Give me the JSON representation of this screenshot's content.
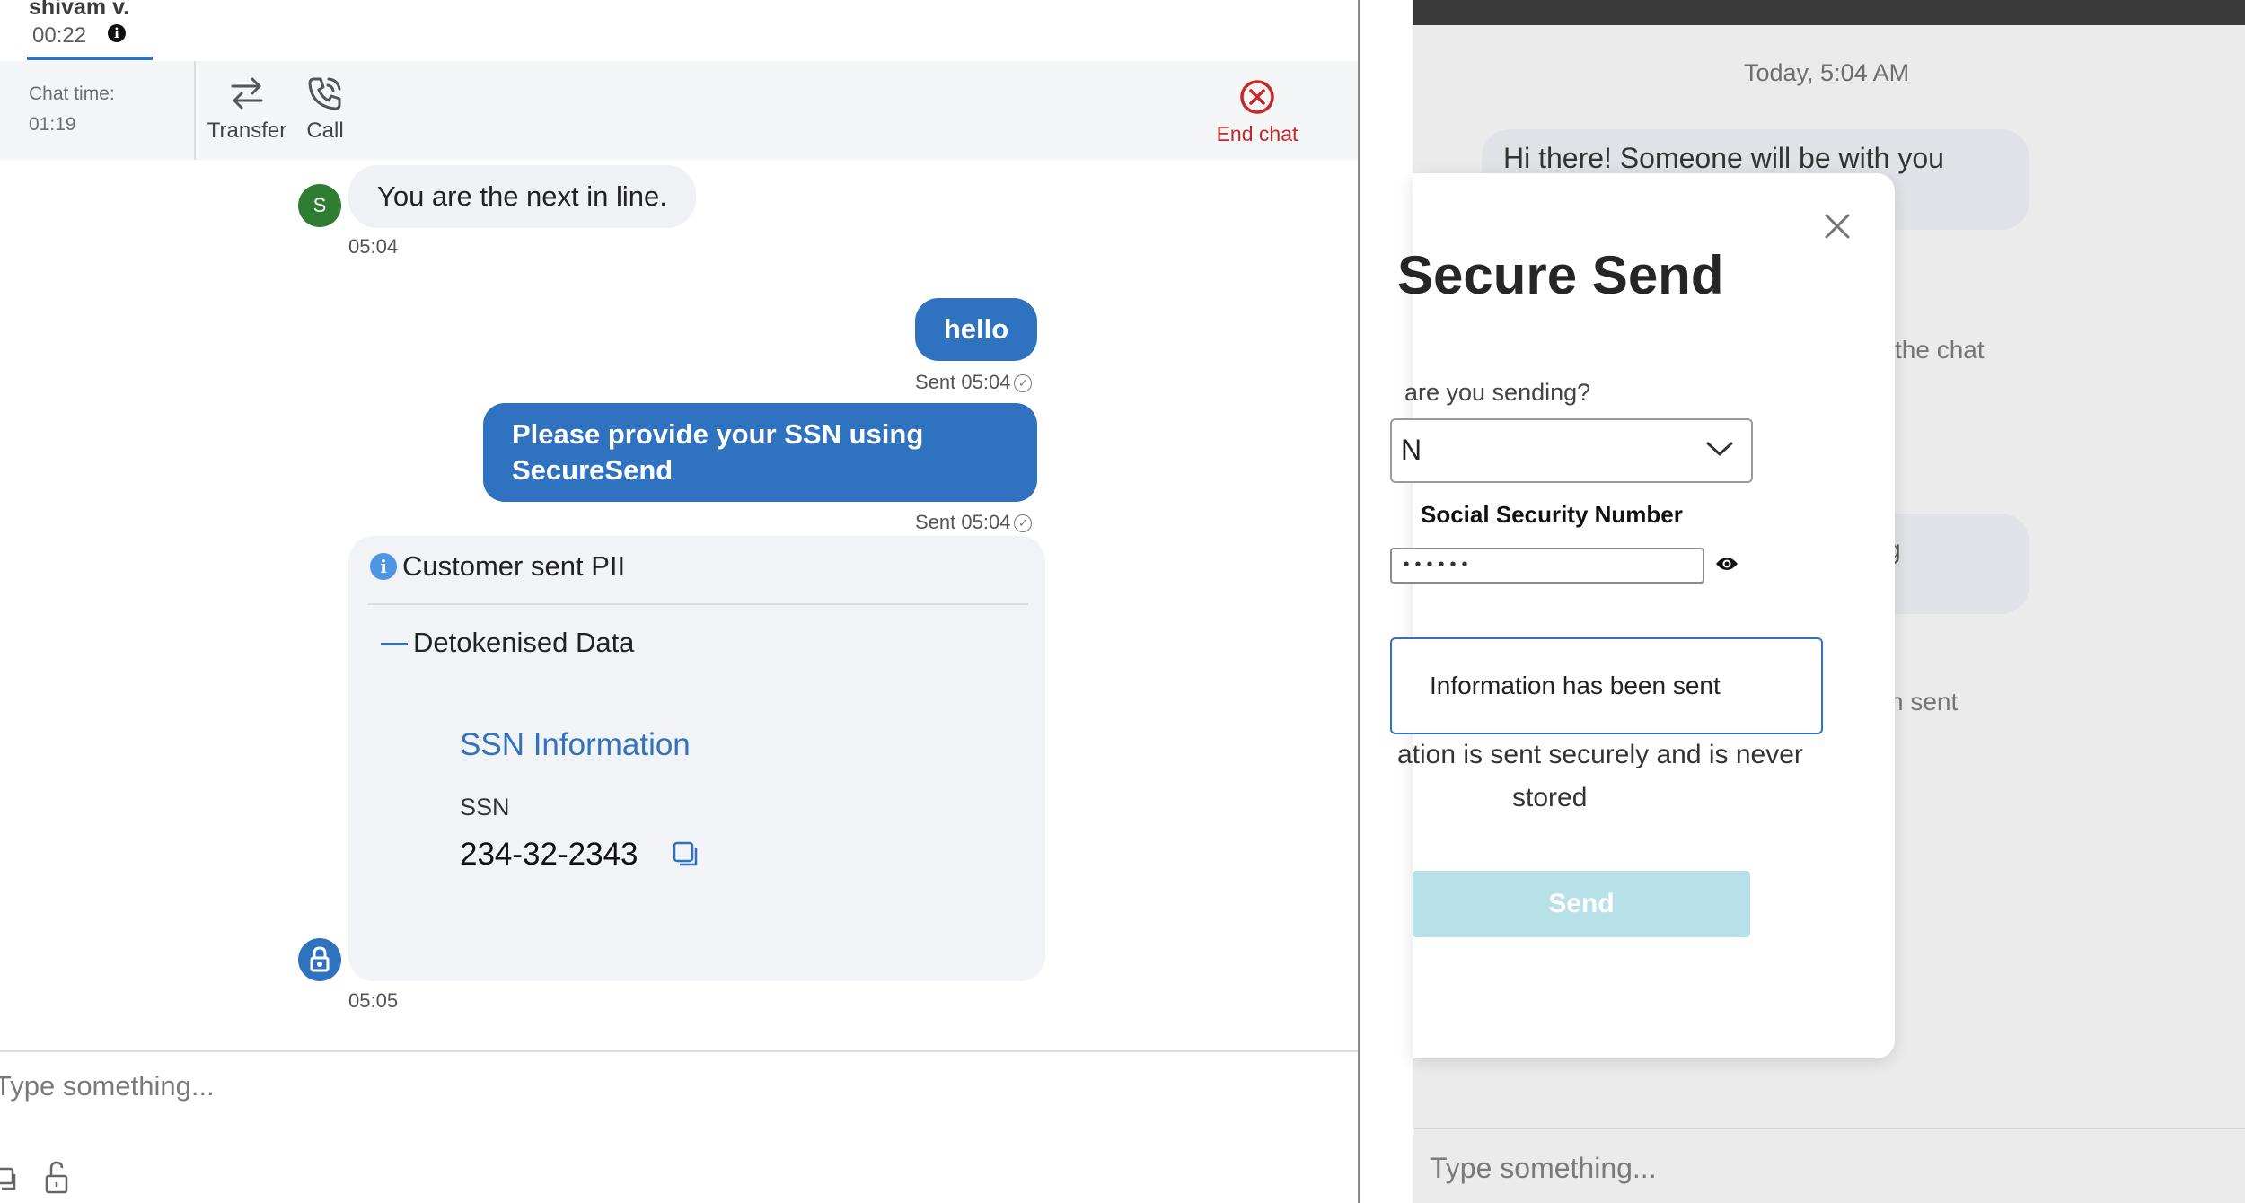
{
  "agent": {
    "name": "shivam v.",
    "timer": "00:22",
    "info_icon": "i"
  },
  "toolbar": {
    "chat_time_label": "Chat time:",
    "chat_time_value": "01:19",
    "transfer_label": "Transfer",
    "call_label": "Call",
    "end_chat_label": "End chat",
    "accent": "#2f73c0",
    "end_chat_color": "#c62828"
  },
  "messages": {
    "incoming_avatar": "S",
    "incoming_text": "You are the next in line.",
    "incoming_time": "05:04",
    "out1_text": "hello",
    "out1_status": "Sent 05:04",
    "out2_text": "Please provide your SSN using SecureSend",
    "out2_status": "Sent 05:04",
    "pii_info_icon": "i",
    "pii_title": "Customer sent PII",
    "detok_label": "Detokenised Data",
    "ssn_heading": "SSN Information",
    "ssn_label": "SSN",
    "ssn_value": "234-32-2343",
    "pii_time": "05:05"
  },
  "compose": {
    "placeholder": "Type something..."
  },
  "customer": {
    "date_header": "Today, 5:04 AM",
    "bubble1_text": "Hi there! Someone will be with you",
    "partial_text_1": "the chat",
    "partial_text_2": "g",
    "partial_text_3": "n sent",
    "compose_placeholder": "Type something..."
  },
  "modal": {
    "title": "Secure Send",
    "question": "are you sending?",
    "selected_value": "N",
    "ssn_field_label": "Social Security Number",
    "ssn_masked": "••••••",
    "status_text": "Information has been sent",
    "secure_note_line1": "ation is sent securely and is never",
    "secure_note_line2": "stored",
    "send_label": "Send",
    "send_color": "#b8e0e8"
  },
  "icons": [
    "info-icon",
    "transfer-icon",
    "call-icon",
    "end-chat-icon",
    "check-icon",
    "copy-icon",
    "lock-icon",
    "attachment-icon",
    "unlock-icon",
    "close-icon",
    "chevron-down-icon",
    "eye-icon"
  ]
}
